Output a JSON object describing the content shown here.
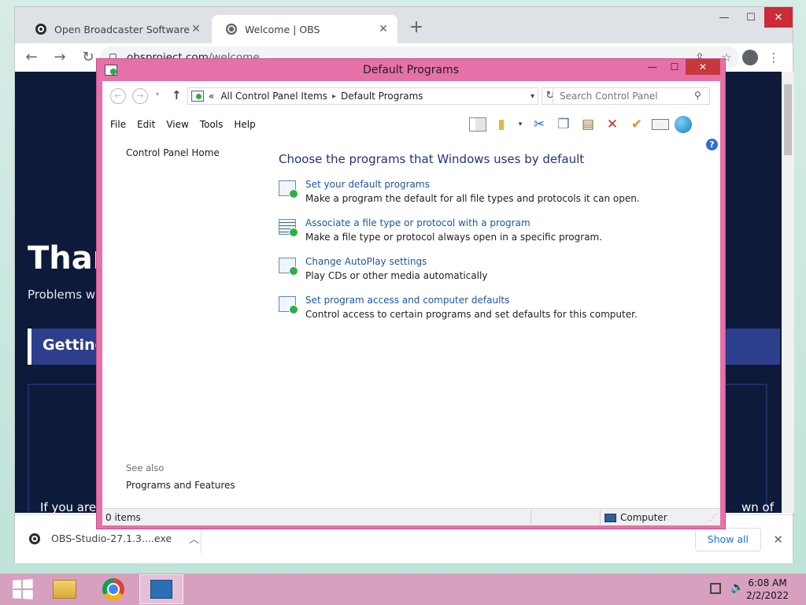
{
  "chrome": {
    "tabs": [
      {
        "title": "Open Broadcaster Software | OBS",
        "close": "✕"
      },
      {
        "title": "Welcome | OBS",
        "close": "✕"
      }
    ],
    "new_tab": "+",
    "window_controls": {
      "minimize": "—",
      "maximize": "☐",
      "close": "✕"
    },
    "nav": {
      "back": "←",
      "forward": "→",
      "reload": "↻"
    },
    "url_host": "obsproject.com",
    "url_path": "/welcome",
    "toolbar_icons": {
      "share": "⇪",
      "star": "☆",
      "menu": "⋮"
    },
    "page": {
      "heading": "Than",
      "subtext": "Problems wi",
      "getting": "Getting",
      "footer_left": "If you are",
      "footer_right": "wn of"
    },
    "download": {
      "file": "OBS-Studio-27.1.3....exe",
      "chevron": "︿",
      "show_all": "Show all",
      "close": "✕"
    }
  },
  "control_panel": {
    "title": "Default Programs",
    "window_controls": {
      "minimize": "—",
      "maximize": "☐",
      "close": "✕"
    },
    "nav": {
      "back": "←",
      "forward": "→",
      "dropdown": "▾",
      "up": "↑",
      "refresh": "↻"
    },
    "breadcrumb": {
      "overflow": "«",
      "root": "All Control Panel Items",
      "sep": "▸",
      "current": "Default Programs",
      "dropdown": "▾"
    },
    "search_placeholder": "Search Control Panel",
    "search_icon": "⚲",
    "menu": [
      "File",
      "Edit",
      "View",
      "Tools",
      "Help"
    ],
    "toolbar_glyphs": {
      "folder": "▮",
      "dropdown": "▾",
      "cut": "✂",
      "copy": "❐",
      "paste": "▤",
      "delete": "✕",
      "properties_check": "✔"
    },
    "help": "?",
    "left_nav_home": "Control Panel Home",
    "see_also": "See also",
    "see_also_link": "Programs and Features",
    "heading": "Choose the programs that Windows uses by default",
    "items": [
      {
        "link": "Set your default programs",
        "desc": "Make a program the default for all file types and protocols it can open."
      },
      {
        "link": "Associate a file type or protocol with a program",
        "desc": "Make a file type or protocol always open in a specific program."
      },
      {
        "link": "Change AutoPlay settings",
        "desc": "Play CDs or other media automatically"
      },
      {
        "link": "Set program access and computer defaults",
        "desc": "Control access to certain programs and set defaults for this computer."
      }
    ],
    "status_items": "0 items",
    "status_location": "Computer",
    "status_grip": "⋰"
  },
  "taskbar": {
    "volume": "🔈",
    "time": "6:08 AM",
    "date": "2/2/2022"
  }
}
